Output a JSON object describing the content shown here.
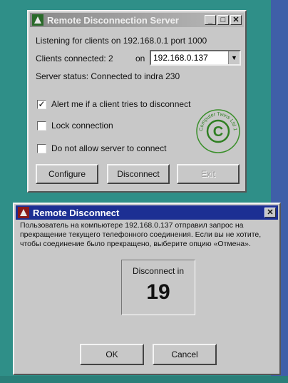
{
  "server_window": {
    "title": "Remote Disconnection Server",
    "listening_text": "Listening for clients on 192.168.0.1 port 1000",
    "clients_label": "Clients connected: 2",
    "on_label": "on",
    "client_select_value": "192.168.0.137",
    "status_text": "Server status:  Connected to indra 230",
    "options": [
      {
        "label": "Alert me if a client tries to disconnect",
        "checked": true
      },
      {
        "label": "Lock connection",
        "checked": false
      },
      {
        "label": "Do not allow server to connect",
        "checked": false
      }
    ],
    "buttons": {
      "configure": "Configure",
      "disconnect": "Disconnect",
      "exit": "Exit"
    },
    "seal_text": "Computer Twins Ltd 1998",
    "seal_mark": "©"
  },
  "dialog": {
    "title": "Remote Disconnect",
    "message": "Пользователь на компьютере 192.168.0.137 отправил запрос на прекращение текущего телефонного соединения. Если вы не хотите, чтобы соединение было прекращено, выберите опцию «Отмена».",
    "countdown_label": "Disconnect in",
    "countdown_value": "19",
    "ok_label": "OK",
    "cancel_label": "Cancel"
  },
  "colors": {
    "desktop": "#2f8f88",
    "dialog_title": "#1c2f93",
    "window_face": "#c8c8c8"
  }
}
